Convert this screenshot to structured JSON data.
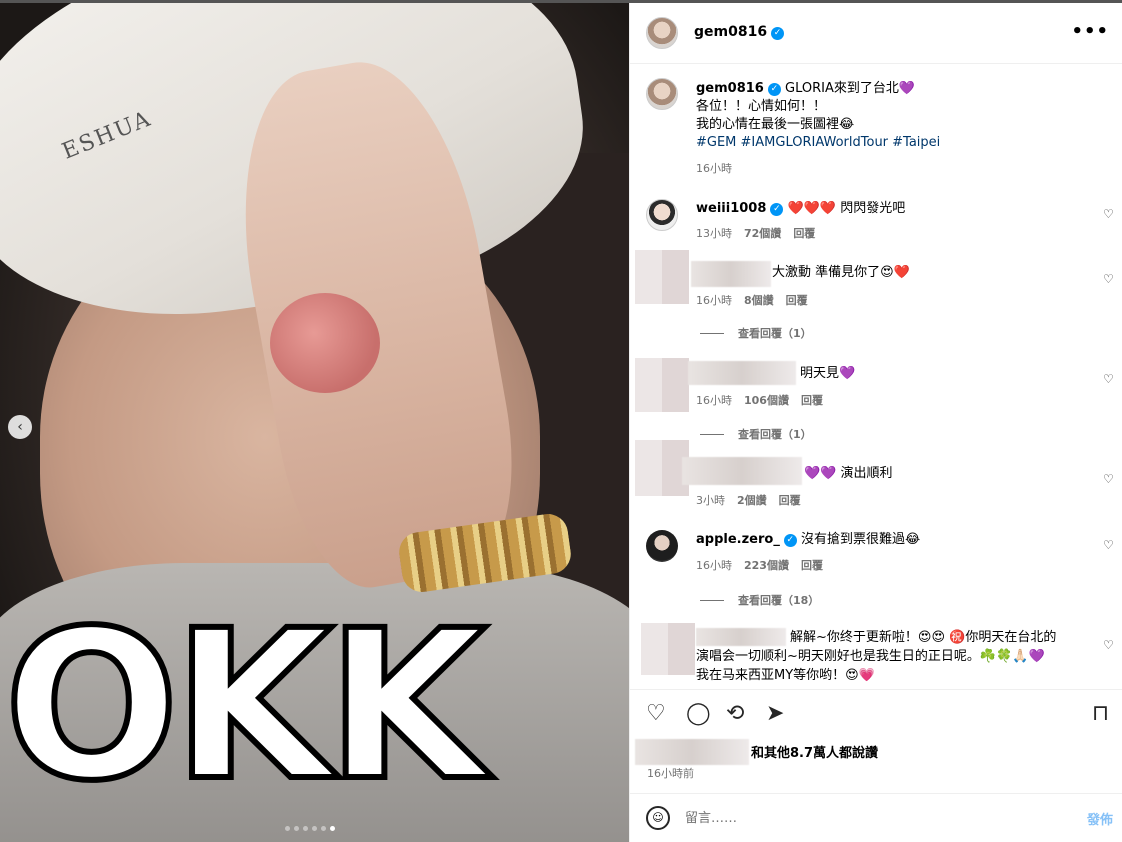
{
  "media": {
    "overlay_text": "OKK",
    "cap_text": "ESHUA",
    "carousel_count": 6,
    "carousel_active": 6
  },
  "header": {
    "username": "gem0816",
    "more_icon": "more-horizontal-icon"
  },
  "caption": {
    "username": "gem0816",
    "line1": "GLORIA來到了台北💜",
    "line2": "各位！！心情如何！！",
    "line3": "我的心情在最後一張圖裡😂",
    "hashtags": "#GEM #IAMGLORIAWorldTour #Taipei",
    "time": "16小時"
  },
  "comments": [
    {
      "username": "weiii1008",
      "verified": true,
      "text": "❤️❤️❤️ 閃閃發光吧",
      "time": "13小時",
      "likes": "72個讚",
      "reply": "回覆"
    },
    {
      "username": "",
      "verified": false,
      "text": "大激動 準備見你了😍❤️",
      "time": "16小時",
      "likes": "8個讚",
      "reply": "回覆",
      "view_replies": "查看回覆（1）"
    },
    {
      "username": "",
      "verified": false,
      "text": "明天見💜",
      "time": "16小時",
      "likes": "106個讚",
      "reply": "回覆",
      "view_replies": "查看回覆（1）"
    },
    {
      "username": "",
      "verified": false,
      "text": "💜💜 演出順利",
      "time": "3小時",
      "likes": "2個讚",
      "reply": "回覆"
    },
    {
      "username": "apple.zero_",
      "verified": true,
      "text": "沒有搶到票很難過😂",
      "time": "16小時",
      "likes": "223個讚",
      "reply": "回覆",
      "view_replies": "查看回覆（18）"
    },
    {
      "username": "",
      "verified": false,
      "text": "解解~你终于更新啦！😍😍 ㊗️你明天在台北的",
      "text2": "演唱会一切顺利~明天刚好也是我生日的正日呢。☘️🍀🙏🏻💜",
      "text3": "我在马来西亚MY等你哟！😍💗"
    }
  ],
  "likes_summary": "和其他8.7萬人都說讚",
  "post_time": "16小時前",
  "comment_box": {
    "placeholder": "留言……",
    "post_label": "發佈"
  },
  "colors": {
    "verified": "#0095f6",
    "hashtag": "#00376b",
    "post_disabled": "#86c1f7"
  }
}
